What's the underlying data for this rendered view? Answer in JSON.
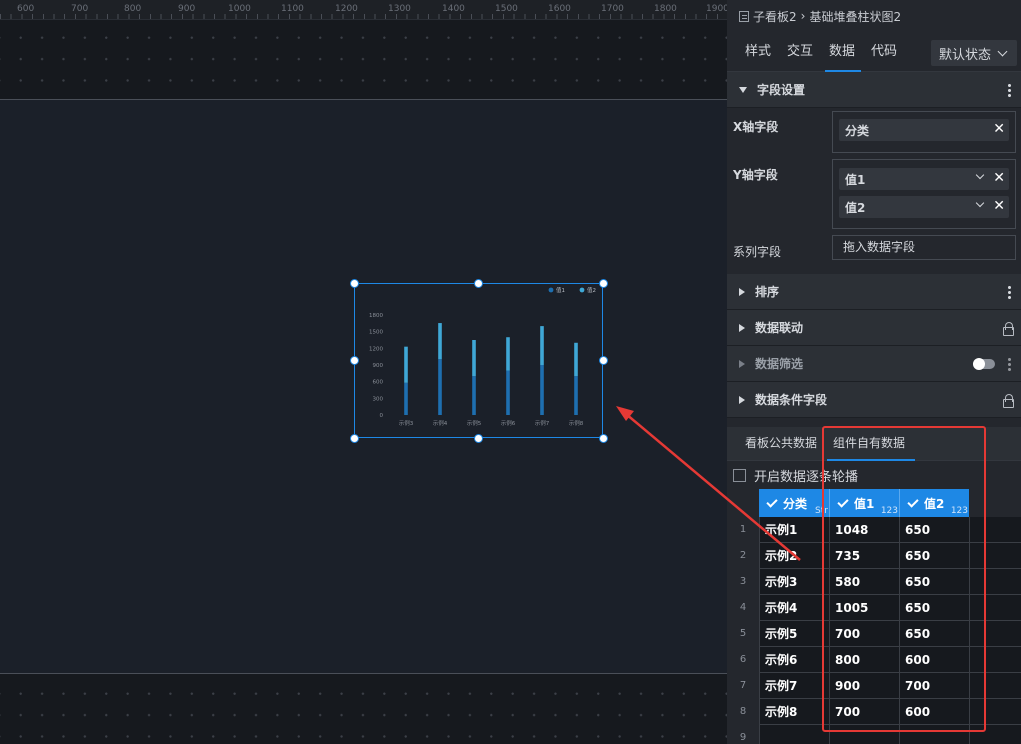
{
  "ruler": {
    "marks": [
      "600",
      "700",
      "800",
      "900",
      "1000",
      "1100",
      "1200",
      "1300",
      "1400",
      "1500",
      "1600",
      "1700",
      "1800",
      "1900"
    ]
  },
  "chart_data": {
    "type": "bar",
    "stacked": true,
    "categories": [
      "示例3",
      "示例4",
      "示例5",
      "示例6",
      "示例7",
      "示例8"
    ],
    "series": [
      {
        "name": "值1",
        "values": [
          580,
          1005,
          700,
          800,
          900,
          700
        ]
      },
      {
        "name": "值2",
        "values": [
          650,
          650,
          650,
          600,
          700,
          600
        ]
      }
    ],
    "ylim": [
      0,
      1800
    ],
    "yticks": [
      "1800",
      "1500",
      "1200",
      "900",
      "600",
      "300",
      "0"
    ],
    "legend": "top-right",
    "colors": {
      "series1": "#1e6fb0",
      "series2": "#3fa8d6"
    }
  },
  "breadcrumb": {
    "parent": "子看板2",
    "sep": "›",
    "current": "基础堆叠柱状图2"
  },
  "tabs": {
    "items": [
      "样式",
      "交互",
      "数据",
      "代码"
    ],
    "active": "数据"
  },
  "state_select": {
    "value": "默认状态"
  },
  "field_settings": {
    "title": "字段设置",
    "x_label": "X轴字段",
    "x_value": "分类",
    "y_label": "Y轴字段",
    "y_values": [
      "值1",
      "值2"
    ],
    "series_label": "系列字段",
    "series_placeholder": "拖入数据字段"
  },
  "sections": {
    "sort": "排序",
    "linkage": "数据联动",
    "filter": "数据筛选",
    "condition": "数据条件字段"
  },
  "data_tabs": {
    "public": "看板公共数据",
    "own": "组件自有数据"
  },
  "carousel_label": "开启数据逐条轮播",
  "table": {
    "headers": [
      "分类",
      "值1",
      "值2"
    ],
    "header_types": [
      "Str",
      "123",
      "123"
    ],
    "rows": [
      {
        "n": "1",
        "c": "示例1",
        "v1": "1048",
        "v2": "650"
      },
      {
        "n": "2",
        "c": "示例2",
        "v1": "735",
        "v2": "650"
      },
      {
        "n": "3",
        "c": "示例3",
        "v1": "580",
        "v2": "650"
      },
      {
        "n": "4",
        "c": "示例4",
        "v1": "1005",
        "v2": "650"
      },
      {
        "n": "5",
        "c": "示例5",
        "v1": "700",
        "v2": "650"
      },
      {
        "n": "6",
        "c": "示例6",
        "v1": "800",
        "v2": "600"
      },
      {
        "n": "7",
        "c": "示例7",
        "v1": "900",
        "v2": "700"
      },
      {
        "n": "8",
        "c": "示例8",
        "v1": "700",
        "v2": "600"
      },
      {
        "n": "9",
        "c": "",
        "v1": "",
        "v2": ""
      }
    ]
  },
  "icons": {
    "close": "close-icon",
    "chevron": "chevron-down-icon",
    "lock": "lock-icon",
    "more": "more-vertical-icon"
  },
  "annotation_color": "#e53935",
  "accent_color": "#1e88e5"
}
